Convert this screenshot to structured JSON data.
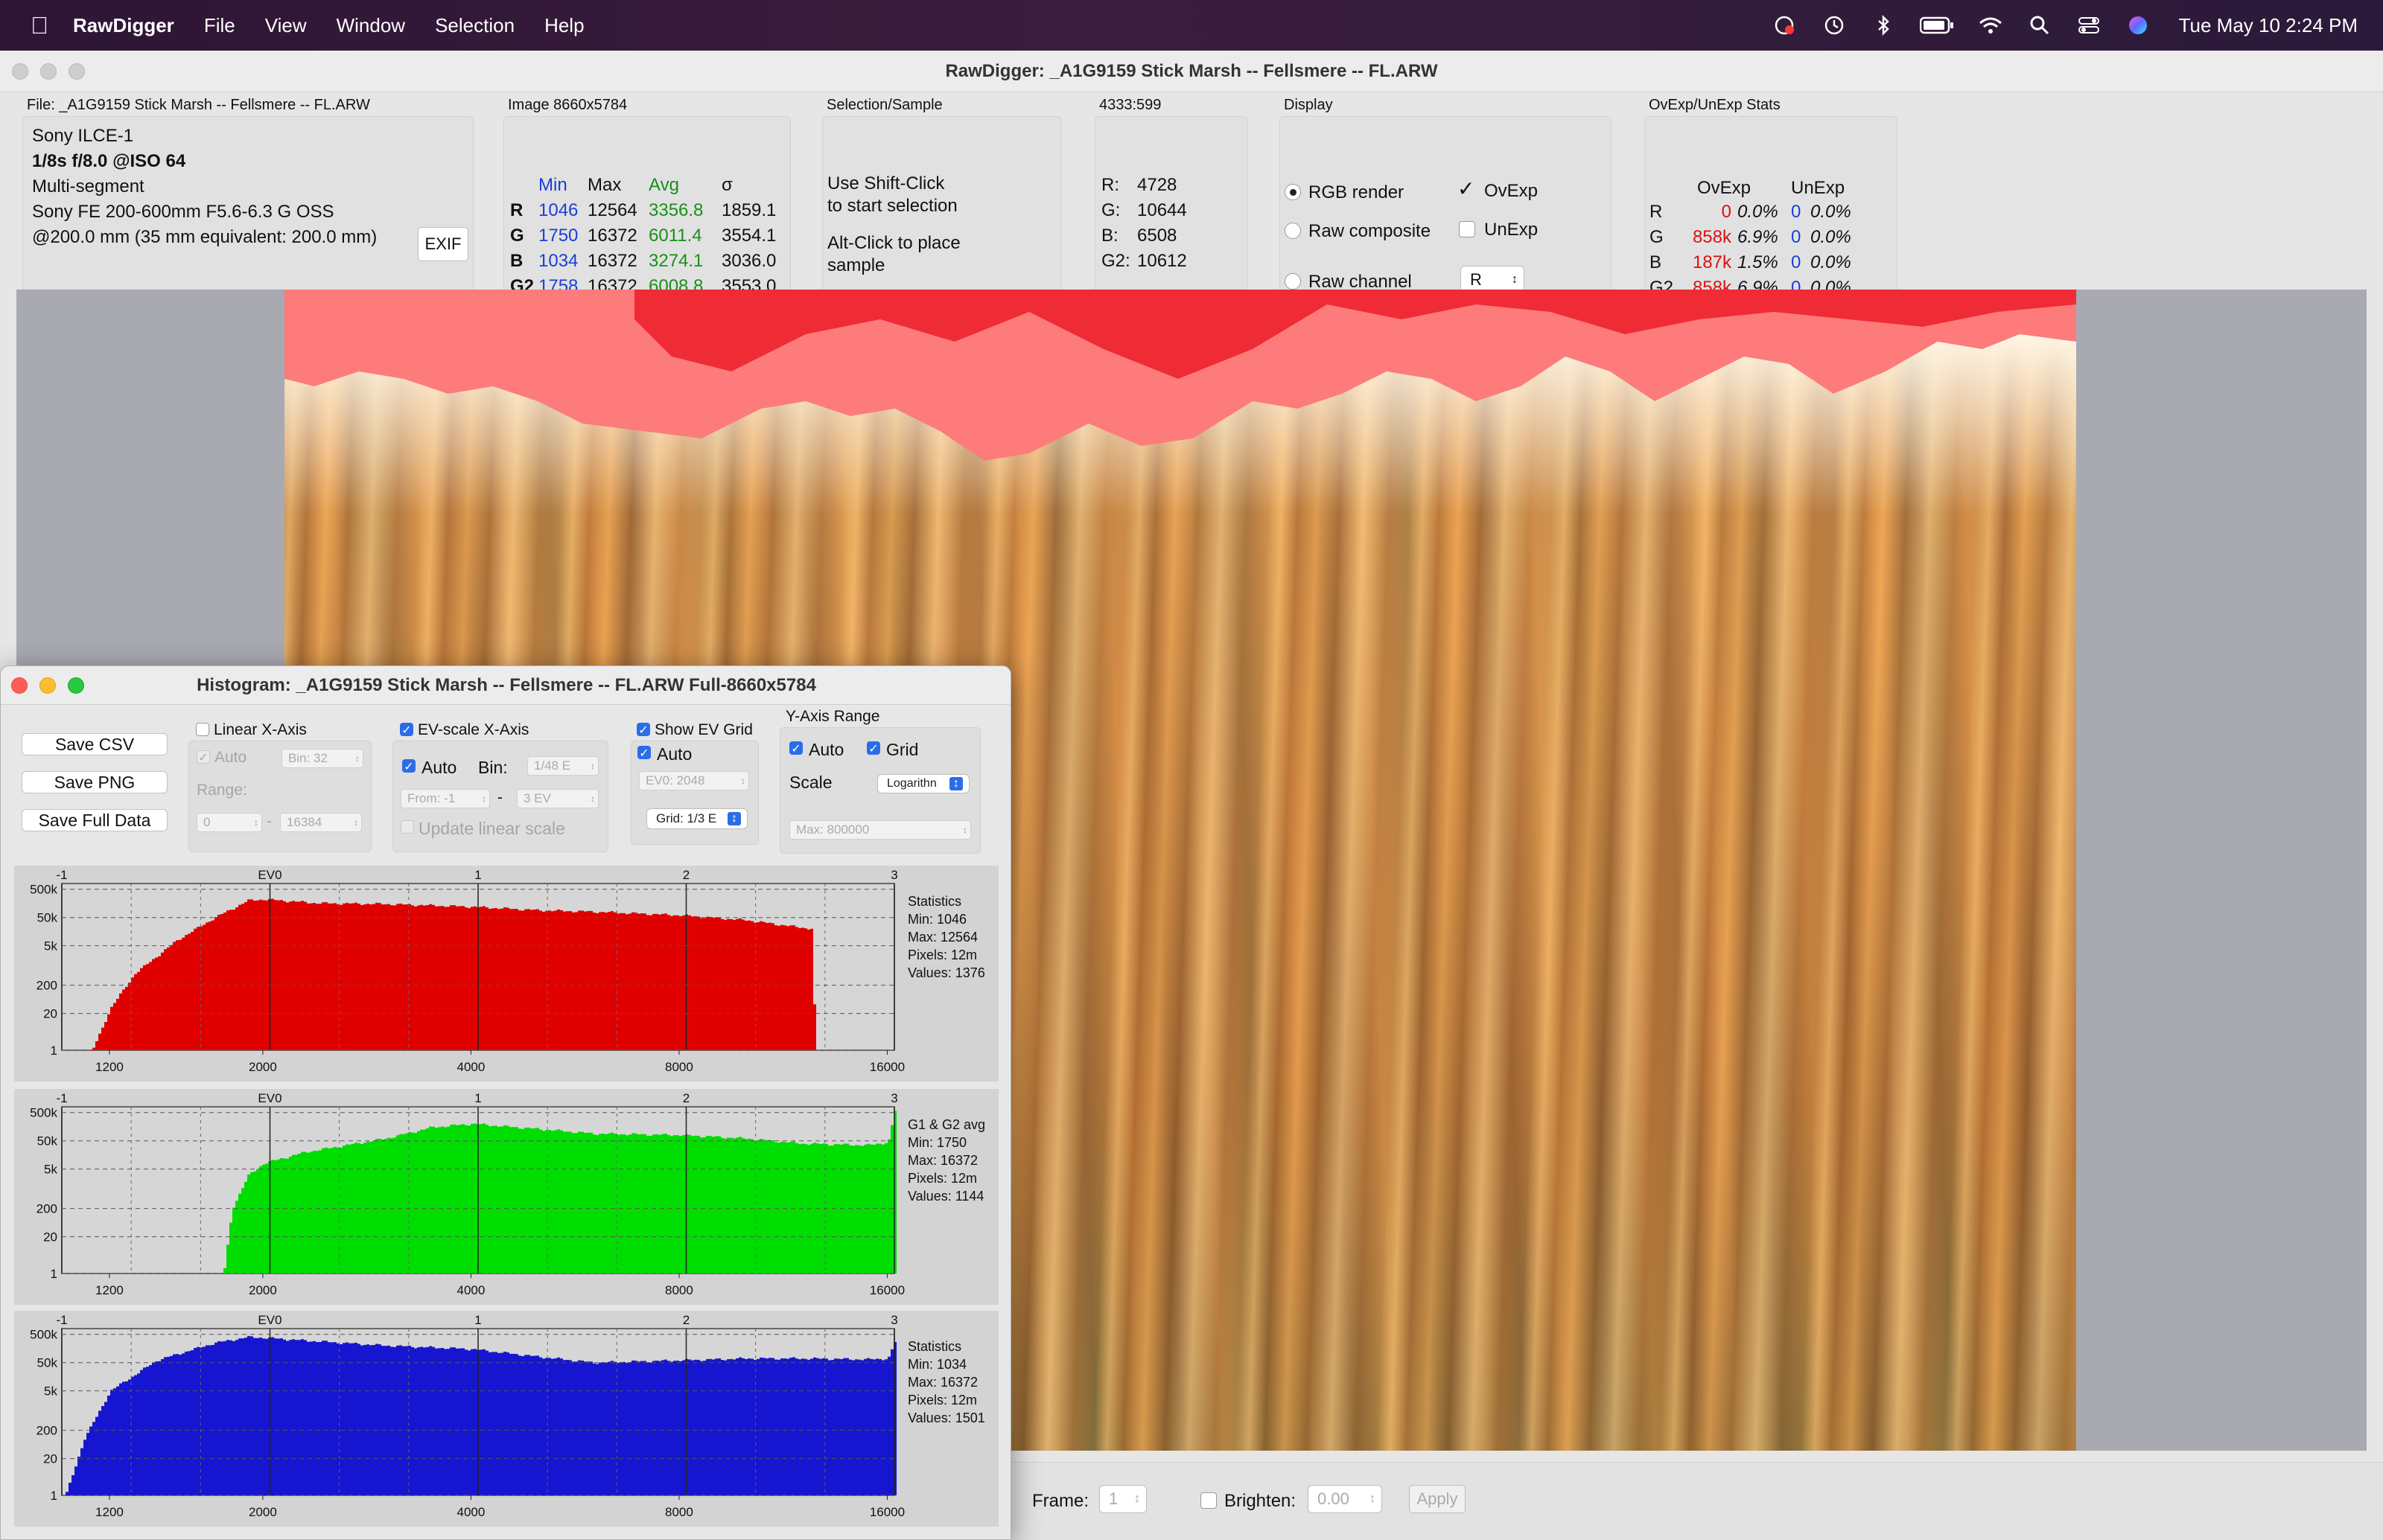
{
  "menubar": {
    "apple_icon": "apple-logo-icon",
    "app_name": "RawDigger",
    "items": [
      "File",
      "View",
      "Window",
      "Selection",
      "Help"
    ],
    "status_icons": [
      "screen-record-icon",
      "time-machine-icon",
      "bluetooth-icon",
      "battery-icon",
      "wifi-icon",
      "spotlight-search-icon",
      "control-center-icon",
      "siri-icon"
    ],
    "clock": "Tue May 10  2:24 PM"
  },
  "main": {
    "title": "RawDigger: _A1G9159 Stick Marsh -- Fellsmere --  FL.ARW",
    "file": {
      "label": "File: _A1G9159 Stick Marsh -- Fellsmere --  FL.ARW",
      "camera": "Sony ILCE-1",
      "exposure": "1/8s f/8.0 @ISO 64",
      "metering": "Multi-segment",
      "lens": "Sony FE 200-600mm F5.6-6.3 G OSS",
      "focal": "@200.0 mm (35 mm equivalent: 200.0 mm)",
      "exif_button": "EXIF"
    },
    "image": {
      "label": "Image 8660x5784",
      "headers": [
        "Min",
        "Max",
        "Avg",
        "σ"
      ],
      "rows": [
        {
          "ch": "R",
          "min": "1046",
          "max": "12564",
          "avg": "3356.8",
          "sigma": "1859.1"
        },
        {
          "ch": "G",
          "min": "1750",
          "max": "16372",
          "avg": "6011.4",
          "sigma": "3554.1"
        },
        {
          "ch": "B",
          "min": "1034",
          "max": "16372",
          "avg": "3274.1",
          "sigma": "3036.0"
        },
        {
          "ch": "G2",
          "min": "1758",
          "max": "16372",
          "avg": "6008.8",
          "sigma": "3553.0"
        }
      ]
    },
    "selection": {
      "label": "Selection/Sample",
      "line1": "Use Shift-Click",
      "line2": "to start selection",
      "line3": "Alt-Click to place",
      "line4": "sample"
    },
    "sample": {
      "label": "4333:599",
      "rows": [
        {
          "ch": "R:",
          "val": "4728"
        },
        {
          "ch": "G:",
          "val": "10644"
        },
        {
          "ch": "B:",
          "val": "6508"
        },
        {
          "ch": "G2:",
          "val": "10612"
        }
      ]
    },
    "display": {
      "label": "Display",
      "rgb_render": "RGB render",
      "raw_composite": "Raw composite",
      "raw_channel": "Raw channel",
      "ovexp": "OvExp",
      "unexp": "UnExp",
      "channel_value": "R"
    },
    "stats": {
      "label": "OvExp/UnExp Stats",
      "headers": [
        "OvExp",
        "UnExp"
      ],
      "rows": [
        {
          "ch": "R",
          "ov": "0",
          "ovp": "0.0%",
          "un": "0",
          "unp": "0.0%"
        },
        {
          "ch": "G",
          "ov": "858k",
          "ovp": "6.9%",
          "un": "0",
          "unp": "0.0%"
        },
        {
          "ch": "B",
          "ov": "187k",
          "ovp": "1.5%",
          "un": "0",
          "unp": "0.0%"
        },
        {
          "ch": "G2",
          "ov": "858k",
          "ovp": "6.9%",
          "un": "0",
          "unp": "0.0%"
        }
      ]
    },
    "bottom": {
      "frame_label": "Frame:",
      "frame_value": "1",
      "brighten_label": "Brighten:",
      "brighten_value": "0.00",
      "apply": "Apply"
    }
  },
  "histogram_window": {
    "title": "Histogram: _A1G9159 Stick Marsh -- Fellsmere --  FL.ARW Full-8660x5784",
    "save_csv": "Save CSV",
    "save_png": "Save PNG",
    "save_full": "Save Full Data",
    "linear": {
      "title": "Linear X-Axis",
      "auto": "Auto",
      "bin": "Bin: 32",
      "range": "Range:",
      "from": "0",
      "dash": "-",
      "to": "16384"
    },
    "ev": {
      "title": "EV-scale X-Axis",
      "auto": "Auto",
      "bin_label": "Bin:",
      "bin": "1/48 E",
      "from": "From: -1",
      "dash": "-",
      "to": "3 EV",
      "update": "Update linear scale"
    },
    "grid": {
      "title": "Show EV Grid",
      "auto": "Auto",
      "ev0": "EV0: 2048",
      "grid": "Grid: 1/3 E"
    },
    "yaxis": {
      "title": "Y-Axis Range",
      "auto": "Auto",
      "grid": "Grid",
      "scale": "Scale",
      "scale_value": "Logarithn",
      "max": "Max: 800000"
    },
    "tick_labels": {
      "ev_top": [
        "-1",
        "EV0",
        "1",
        "2",
        "3"
      ],
      "y_left": [
        "500k",
        "50k",
        "5k",
        "200",
        "20",
        "1"
      ],
      "x_bottom": [
        "1200",
        "2000",
        "4000",
        "8000",
        "16000"
      ]
    },
    "panels": [
      {
        "stat_title": "Statistics",
        "min": "Min: 1046",
        "max": "Max: 12564",
        "pixels": "Pixels: 12m",
        "values": "Values: 1376"
      },
      {
        "stat_title": "G1 & G2 avg",
        "min": "Min: 1750",
        "max": "Max: 16372",
        "pixels": "Pixels: 12m",
        "values": "Values: 1144"
      },
      {
        "stat_title": "Statistics",
        "min": "Min: 1034",
        "max": "Max: 16372",
        "pixels": "Pixels: 12m",
        "values": "Values: 1501"
      }
    ]
  },
  "chart_data": [
    {
      "type": "area",
      "series": [
        {
          "name": "R",
          "color": "#e00000"
        }
      ],
      "x_scale": "log2 (EV)",
      "xlim": [
        1024,
        16384
      ],
      "y_scale": "log",
      "ylim": [
        1,
        800000
      ],
      "x": [
        1130,
        1200,
        1300,
        1500,
        1700,
        1900,
        2000,
        2400,
        3000,
        4000,
        5000,
        6000,
        8000,
        10000,
        11500,
        12400,
        12564
      ],
      "y": [
        1,
        30,
        500,
        8000,
        50000,
        200000,
        220000,
        160000,
        150000,
        120000,
        90000,
        80000,
        60000,
        40000,
        25000,
        20000,
        1
      ]
    },
    {
      "type": "area",
      "series": [
        {
          "name": "G1 & G2 avg",
          "color": "#00dd00"
        }
      ],
      "x_scale": "log2 (EV)",
      "xlim": [
        1024,
        16384
      ],
      "y_scale": "log",
      "ylim": [
        1,
        800000
      ],
      "x": [
        1750,
        1800,
        1900,
        2000,
        2300,
        3000,
        3500,
        4000,
        5000,
        6000,
        8000,
        10000,
        12000,
        15000,
        16000,
        16372
      ],
      "y": [
        1,
        200,
        3000,
        8000,
        20000,
        60000,
        150000,
        200000,
        130000,
        90000,
        80000,
        60000,
        40000,
        35000,
        45000,
        700000
      ]
    },
    {
      "type": "area",
      "series": [
        {
          "name": "B",
          "color": "#1616d0"
        }
      ],
      "x_scale": "log2 (EV)",
      "xlim": [
        1024,
        16384
      ],
      "y_scale": "log",
      "ylim": [
        1,
        800000
      ],
      "x": [
        1034,
        1100,
        1200,
        1400,
        1700,
        1900,
        2000,
        2300,
        3000,
        4000,
        5000,
        6000,
        8000,
        10000,
        12000,
        15000,
        16000,
        16372
      ],
      "y": [
        1,
        100,
        5000,
        60000,
        250000,
        400000,
        380000,
        300000,
        200000,
        150000,
        80000,
        50000,
        60000,
        70000,
        70000,
        65000,
        70000,
        300000
      ]
    }
  ]
}
